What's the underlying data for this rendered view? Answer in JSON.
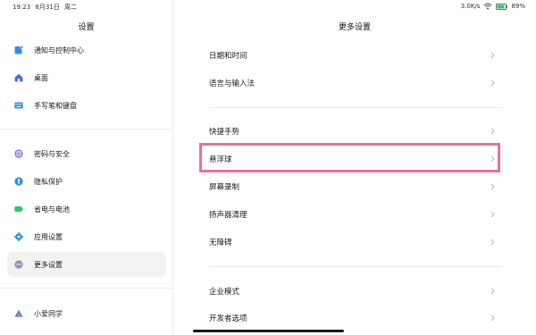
{
  "status_bar": {
    "time": "19:23",
    "date": "8月31日",
    "weekday": "周二",
    "network_speed": "3.0K/s",
    "battery_percent": "89%",
    "battery_level": 0.89
  },
  "left_panel": {
    "title": "设置",
    "items": [
      {
        "label": "通知与控制中心",
        "icon": "notification-icon",
        "color": "#2f8cf0"
      },
      {
        "label": "桌面",
        "icon": "home-icon",
        "color": "#4a6bea"
      },
      {
        "label": "手写笔和键盘",
        "icon": "keyboard-icon",
        "color": "#2f8cf0"
      },
      {
        "label": "密码与安全",
        "icon": "fingerprint-icon",
        "color": "#6d6ef0"
      },
      {
        "label": "隐私保护",
        "icon": "privacy-icon",
        "color": "#2f8cf0"
      },
      {
        "label": "省电与电池",
        "icon": "battery-icon",
        "color": "#2dc76d"
      },
      {
        "label": "应用设置",
        "icon": "gear-icon",
        "color": "#2f8cf0"
      },
      {
        "label": "更多设置",
        "icon": "more-icon",
        "color": "#8a98b5",
        "active": true
      },
      {
        "label": "小爱同学",
        "icon": "xiaoai-icon",
        "color": "#3c7df0"
      }
    ]
  },
  "right_panel": {
    "title": "更多设置",
    "rows": [
      {
        "label": "日期和时间"
      },
      {
        "label": "语言与输入法"
      },
      {
        "label": "快捷手势"
      },
      {
        "label": "悬浮球",
        "highlighted": true
      },
      {
        "label": "屏幕录制"
      },
      {
        "label": "扬声器清理"
      },
      {
        "label": "无障碍"
      },
      {
        "label": "企业模式"
      },
      {
        "label": "开发者选项"
      }
    ]
  },
  "colors": {
    "highlight": "#ee6d97",
    "active_bg": "#f2f2f2"
  }
}
